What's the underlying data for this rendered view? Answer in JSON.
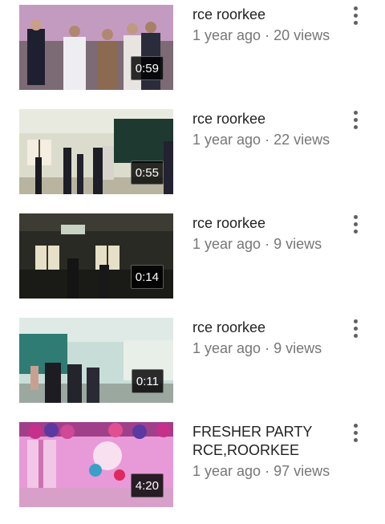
{
  "colors": {
    "title": "#222222",
    "meta": "#767676",
    "duration_bg": "#000000",
    "duration_text": "#ffffff",
    "menu_icon": "#606060"
  },
  "videos": [
    {
      "title": "rce roorkee",
      "age": "1 year ago",
      "separator": "·",
      "views": "20 views",
      "duration": "0:59",
      "menu_icon": "more-vert-icon"
    },
    {
      "title": "rce roorkee",
      "age": "1 year ago",
      "separator": "·",
      "views": "22 views",
      "duration": "0:55",
      "menu_icon": "more-vert-icon"
    },
    {
      "title": "rce roorkee",
      "age": "1 year ago",
      "separator": "·",
      "views": "9 views",
      "duration": "0:14",
      "menu_icon": "more-vert-icon"
    },
    {
      "title": "rce roorkee",
      "age": "1 year ago",
      "separator": "·",
      "views": "9 views",
      "duration": "0:11",
      "menu_icon": "more-vert-icon"
    },
    {
      "title": "FRESHER PARTY RCE,ROORKEE",
      "age": "1 year ago",
      "separator": "·",
      "views": "97 views",
      "duration": "4:20",
      "menu_icon": "more-vert-icon"
    }
  ]
}
